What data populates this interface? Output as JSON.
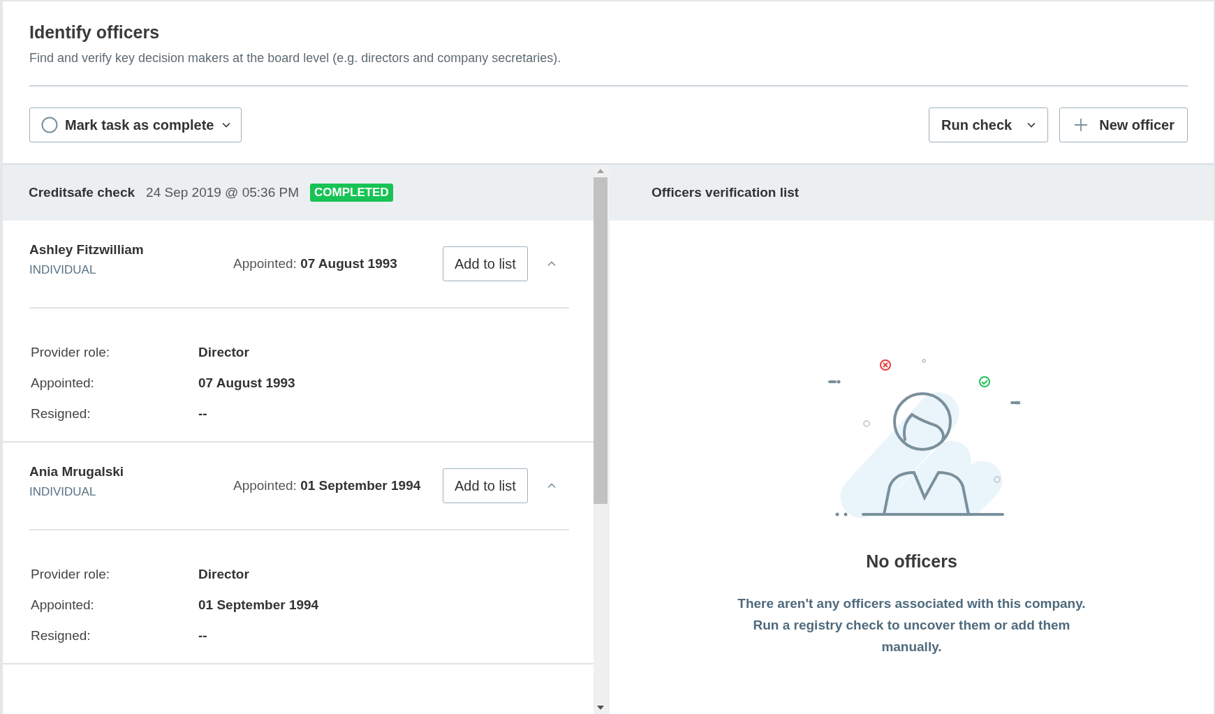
{
  "header": {
    "title": "Identify officers",
    "subtitle": "Find and verify key decision makers at the board level (e.g. directors and company secretaries)."
  },
  "toolbar": {
    "mark_complete": {
      "label": "Mark task as complete",
      "checked": false
    },
    "run_check": {
      "label": "Run check"
    },
    "new_officer": {
      "label": "New officer"
    }
  },
  "check": {
    "name": "Creditsafe check",
    "date": "24 Sep 2019 @ 05:36 PM",
    "status": "COMPLETED"
  },
  "officers": [
    {
      "name": "Ashley Fitzwilliam",
      "type": "INDIVIDUAL",
      "appointed_label": "Appointed:",
      "appointed_value": "07 August 1993",
      "button": "Add to list",
      "expanded": true,
      "details": [
        {
          "label": "Provider role:",
          "value": "Director"
        },
        {
          "label": "Appointed:",
          "value": "07 August 1993"
        },
        {
          "label": "Resigned:",
          "value": "--"
        }
      ]
    },
    {
      "name": "Ania Mrugalski",
      "type": "INDIVIDUAL",
      "appointed_label": "Appointed:",
      "appointed_value": "01 September 1994",
      "button": "Add to list",
      "expanded": true,
      "details": [
        {
          "label": "Provider role:",
          "value": "Director"
        },
        {
          "label": "Appointed:",
          "value": "01 September 1994"
        },
        {
          "label": "Resigned:",
          "value": "--"
        }
      ]
    }
  ],
  "verification": {
    "title": "Officers verification list",
    "empty_title": "No officers",
    "empty_message": "There aren't any officers associated with this company. Run a registry check to uncover them or add them manually."
  }
}
